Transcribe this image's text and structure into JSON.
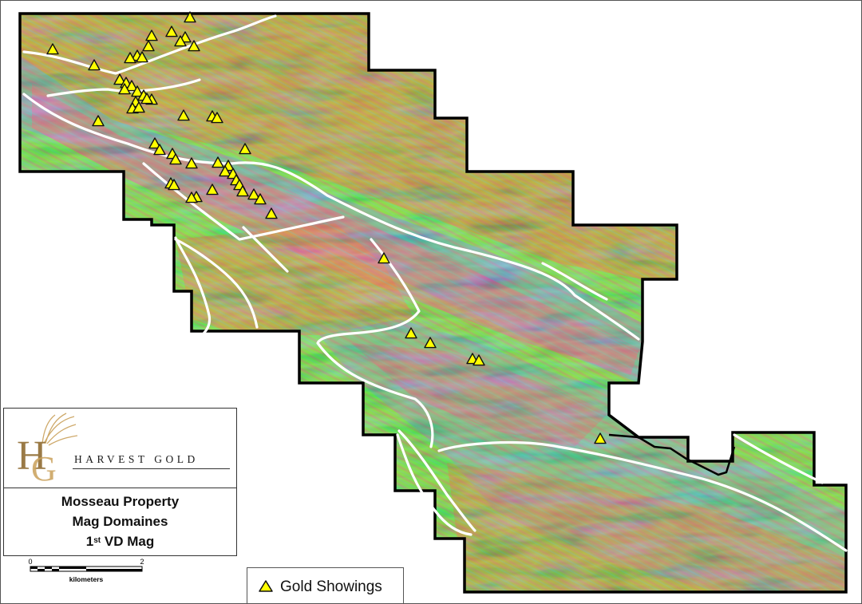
{
  "map": {
    "property_name": "Mosseau Property",
    "subtitle": "Mag Domaines",
    "product_prefix": "1",
    "product_ordinal": "st",
    "product_suffix": " VD Mag"
  },
  "logo": {
    "company_name": "HARVEST GOLD",
    "monogram": "HG"
  },
  "legend": {
    "gold_showings_label": "Gold Showings",
    "symbol": "yellow-triangle-icon",
    "symbol_color": "#ffff00"
  },
  "scale_bar": {
    "start_label": "0",
    "end_label": "2",
    "unit_label": "kilometers"
  },
  "colors": {
    "property_outline": "#000000",
    "domain_boundaries": "#ffffff",
    "mag_high": "#e0102a",
    "mag_mid": "#18d23c",
    "mag_low": "#1d52e0",
    "mag_very_low": "#d9148a",
    "gold_showing": "#ffff00"
  }
}
